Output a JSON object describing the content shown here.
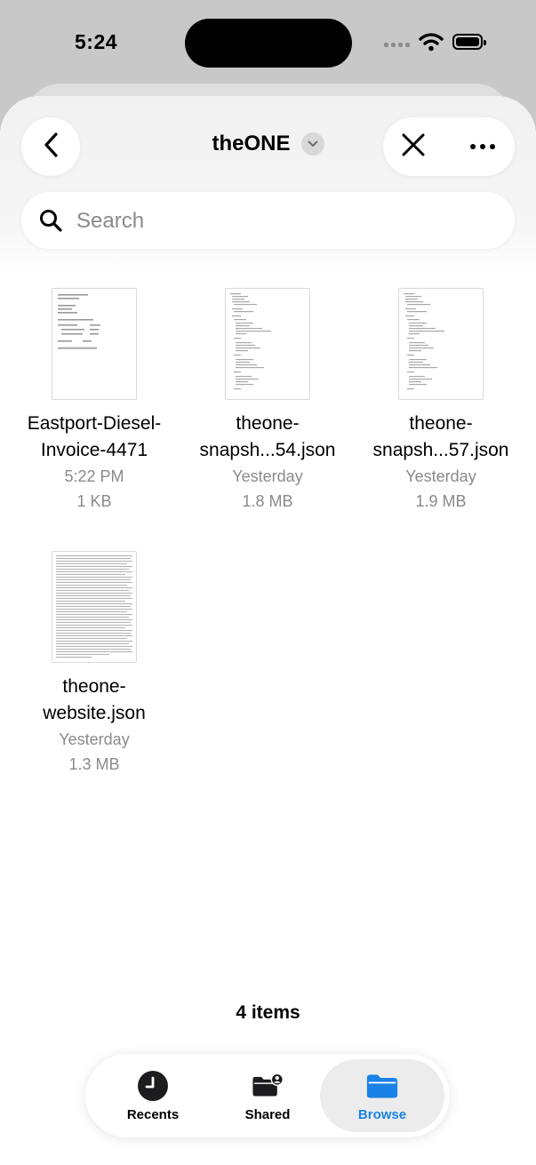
{
  "status": {
    "time": "5:24"
  },
  "header": {
    "title": "theONE",
    "back_icon": "chevron-left-icon",
    "close_icon": "xmark-icon",
    "more_icon": "ellipsis-icon"
  },
  "search": {
    "placeholder": "Search",
    "value": ""
  },
  "files": [
    {
      "name_line1": "Eastport-Diesel-",
      "name_line2": "Invoice-4471",
      "date": "5:22 PM",
      "size": "1 KB"
    },
    {
      "name_line1": "theone-",
      "name_line2": "snapsh...54.json",
      "date": "Yesterday",
      "size": "1.8 MB"
    },
    {
      "name_line1": "theone-",
      "name_line2": "snapsh...57.json",
      "date": "Yesterday",
      "size": "1.9 MB"
    },
    {
      "name_line1": "theone-",
      "name_line2": "website.json",
      "date": "Yesterday",
      "size": "1.3 MB"
    }
  ],
  "footer": {
    "count": "4 items"
  },
  "tabs": [
    {
      "label": "Recents",
      "icon": "clock-icon",
      "active": false
    },
    {
      "label": "Shared",
      "icon": "shared-folder-icon",
      "active": false
    },
    {
      "label": "Browse",
      "icon": "folder-icon",
      "active": true
    }
  ],
  "colors": {
    "accent": "#1a82e6",
    "secondary_text": "#8a8a8e",
    "background": "#ffffff"
  }
}
